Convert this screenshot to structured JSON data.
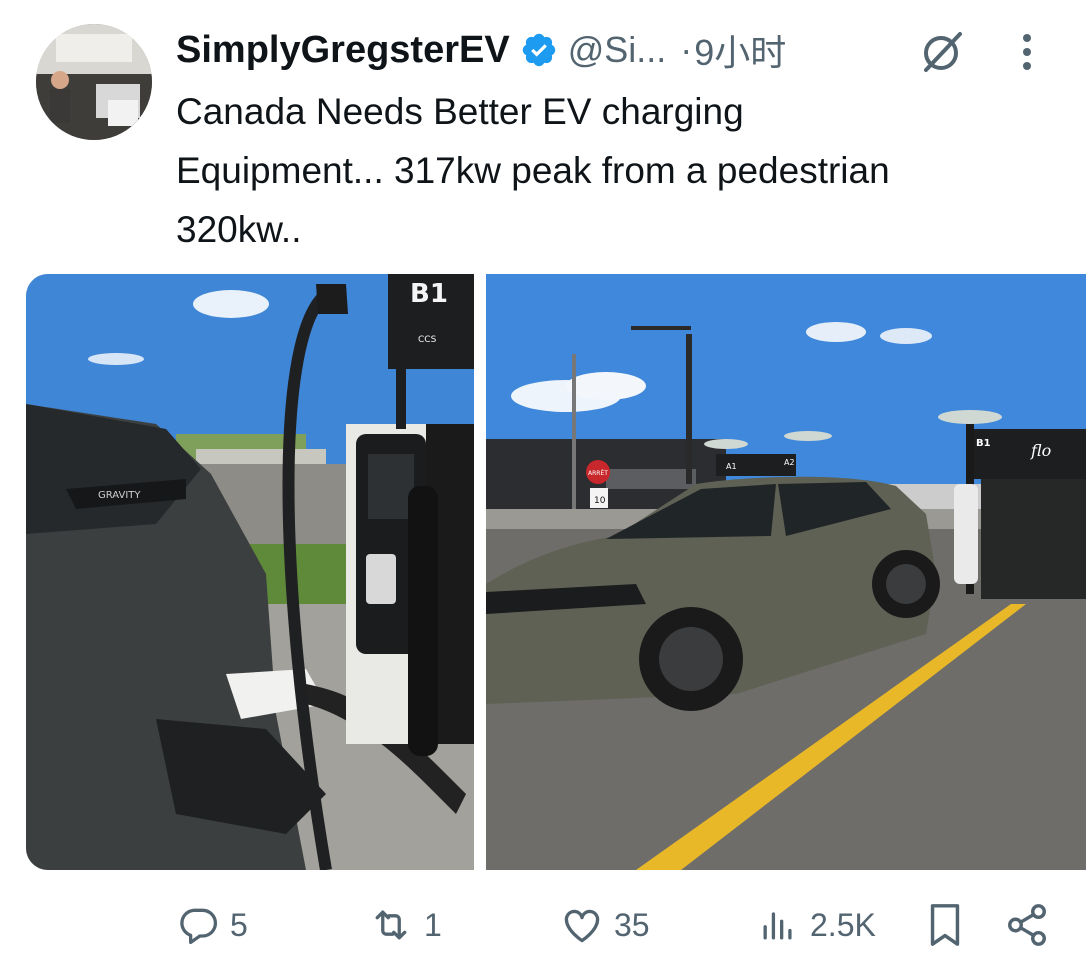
{
  "tweet": {
    "display_name": "SimplyGregsterEV",
    "handle": "@Si...",
    "separator": "·",
    "time": "9小时",
    "text": "Canada Needs Better EV charging\nEquipment... 317kw peak from a pedestrian\n320kw..",
    "verified": true
  },
  "media": {
    "left_photo": {
      "charger_stall": "B1",
      "charger_connector": "CCS",
      "car_badge": "GRAVITY"
    },
    "right_photo": {
      "stop_sign": "ARRÊT",
      "speed_sign": "10",
      "stall_b1": "B1",
      "stall_a1": "A1",
      "stall_a2": "A2",
      "brand": "flo"
    }
  },
  "actions": {
    "reply_count": "5",
    "retweet_count": "1",
    "like_count": "35",
    "views_count": "2.5K"
  },
  "icons": {
    "verified": "verified-badge-icon",
    "grok": "grok-icon",
    "more": "more-dots-icon",
    "reply": "reply-icon",
    "retweet": "retweet-icon",
    "like": "heart-icon",
    "views": "views-icon",
    "bookmark": "bookmark-icon",
    "share": "share-icon"
  },
  "colors": {
    "verified_blue": "#1d9bf0",
    "text": "#0f1419",
    "secondary": "#536471"
  }
}
